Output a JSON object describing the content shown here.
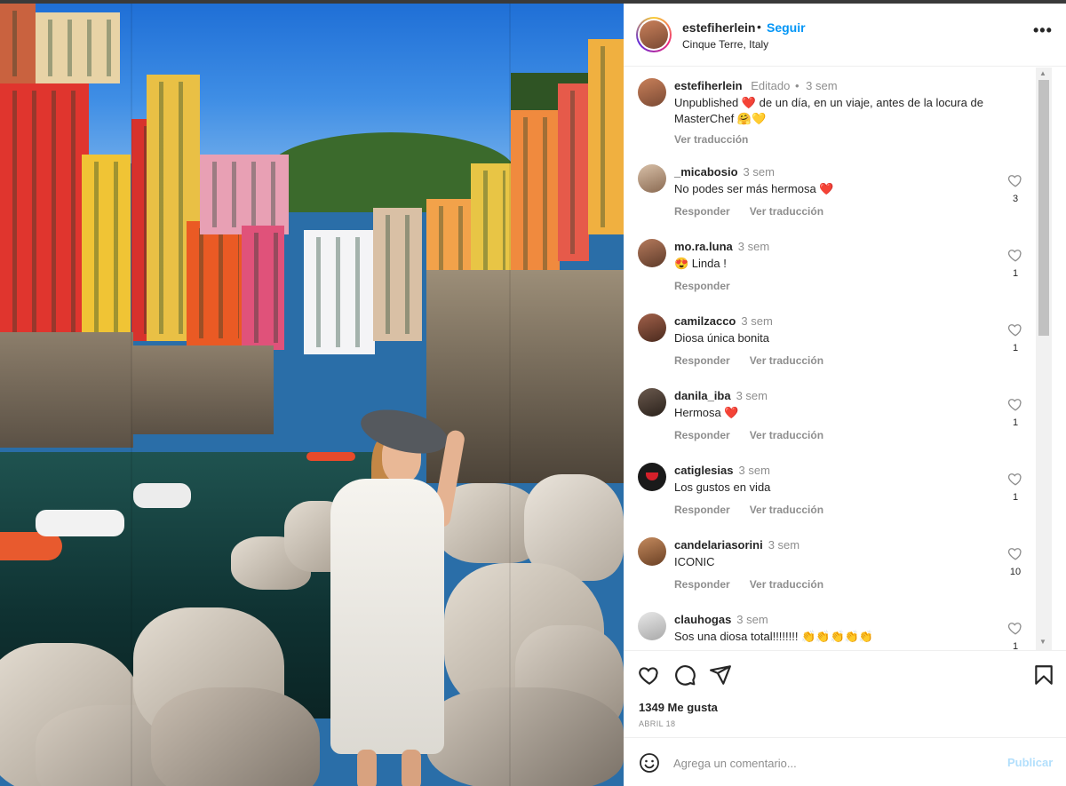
{
  "post": {
    "author": "estefiherlein",
    "follow_label": "Seguir",
    "separator": "•",
    "location": "Cinque Terre, Italy",
    "more_label": "•••",
    "likes_text": "1349 Me gusta",
    "date": "ABRIL 18"
  },
  "caption": {
    "user": "estefiherlein",
    "edited": "Editado",
    "dot": "•",
    "time": "3 sem",
    "text": "Unpublished ❤️ de un día, en un viaje, antes de la locura de MasterChef 🤗💛",
    "translate": "Ver traducción"
  },
  "comments": [
    {
      "user": "_micabosio",
      "time": "3 sem",
      "text": "No podes ser más hermosa ❤️",
      "reply": "Responder",
      "translate": "Ver traducción",
      "likes": "3"
    },
    {
      "user": "mo.ra.luna",
      "time": "3 sem",
      "text": "😍 Linda !",
      "reply": "Responder",
      "translate": "",
      "likes": "1"
    },
    {
      "user": "camilzacco",
      "time": "3 sem",
      "text": "Diosa única bonita",
      "reply": "Responder",
      "translate": "Ver traducción",
      "likes": "1"
    },
    {
      "user": "danila_iba",
      "time": "3 sem",
      "text": "Hermosa ❤️",
      "reply": "Responder",
      "translate": "Ver traducción",
      "likes": "1"
    },
    {
      "user": "catiglesias",
      "time": "3 sem",
      "text": "Los gustos en vida",
      "reply": "Responder",
      "translate": "Ver traducción",
      "likes": "1"
    },
    {
      "user": "candelariasorini",
      "time": "3 sem",
      "text": "ICONIC",
      "reply": "Responder",
      "translate": "Ver traducción",
      "likes": "10"
    },
    {
      "user": "clauhogas",
      "time": "3 sem",
      "text": "Sos una diosa total!!!!!!!! 👏👏👏👏👏",
      "reply": "",
      "translate": "",
      "likes": "1"
    }
  ],
  "composer": {
    "placeholder": "Agrega un comentario...",
    "publish": "Publicar"
  },
  "icons": {
    "like": "heart-icon",
    "comment": "comment-icon",
    "share": "send-icon",
    "save": "bookmark-icon",
    "emoji": "smiley-icon",
    "more": "more-options-icon"
  },
  "colors": {
    "accent": "#0095f6",
    "publish_disabled": "#b2dffc",
    "muted": "#8e8e8e",
    "text": "#262626"
  }
}
